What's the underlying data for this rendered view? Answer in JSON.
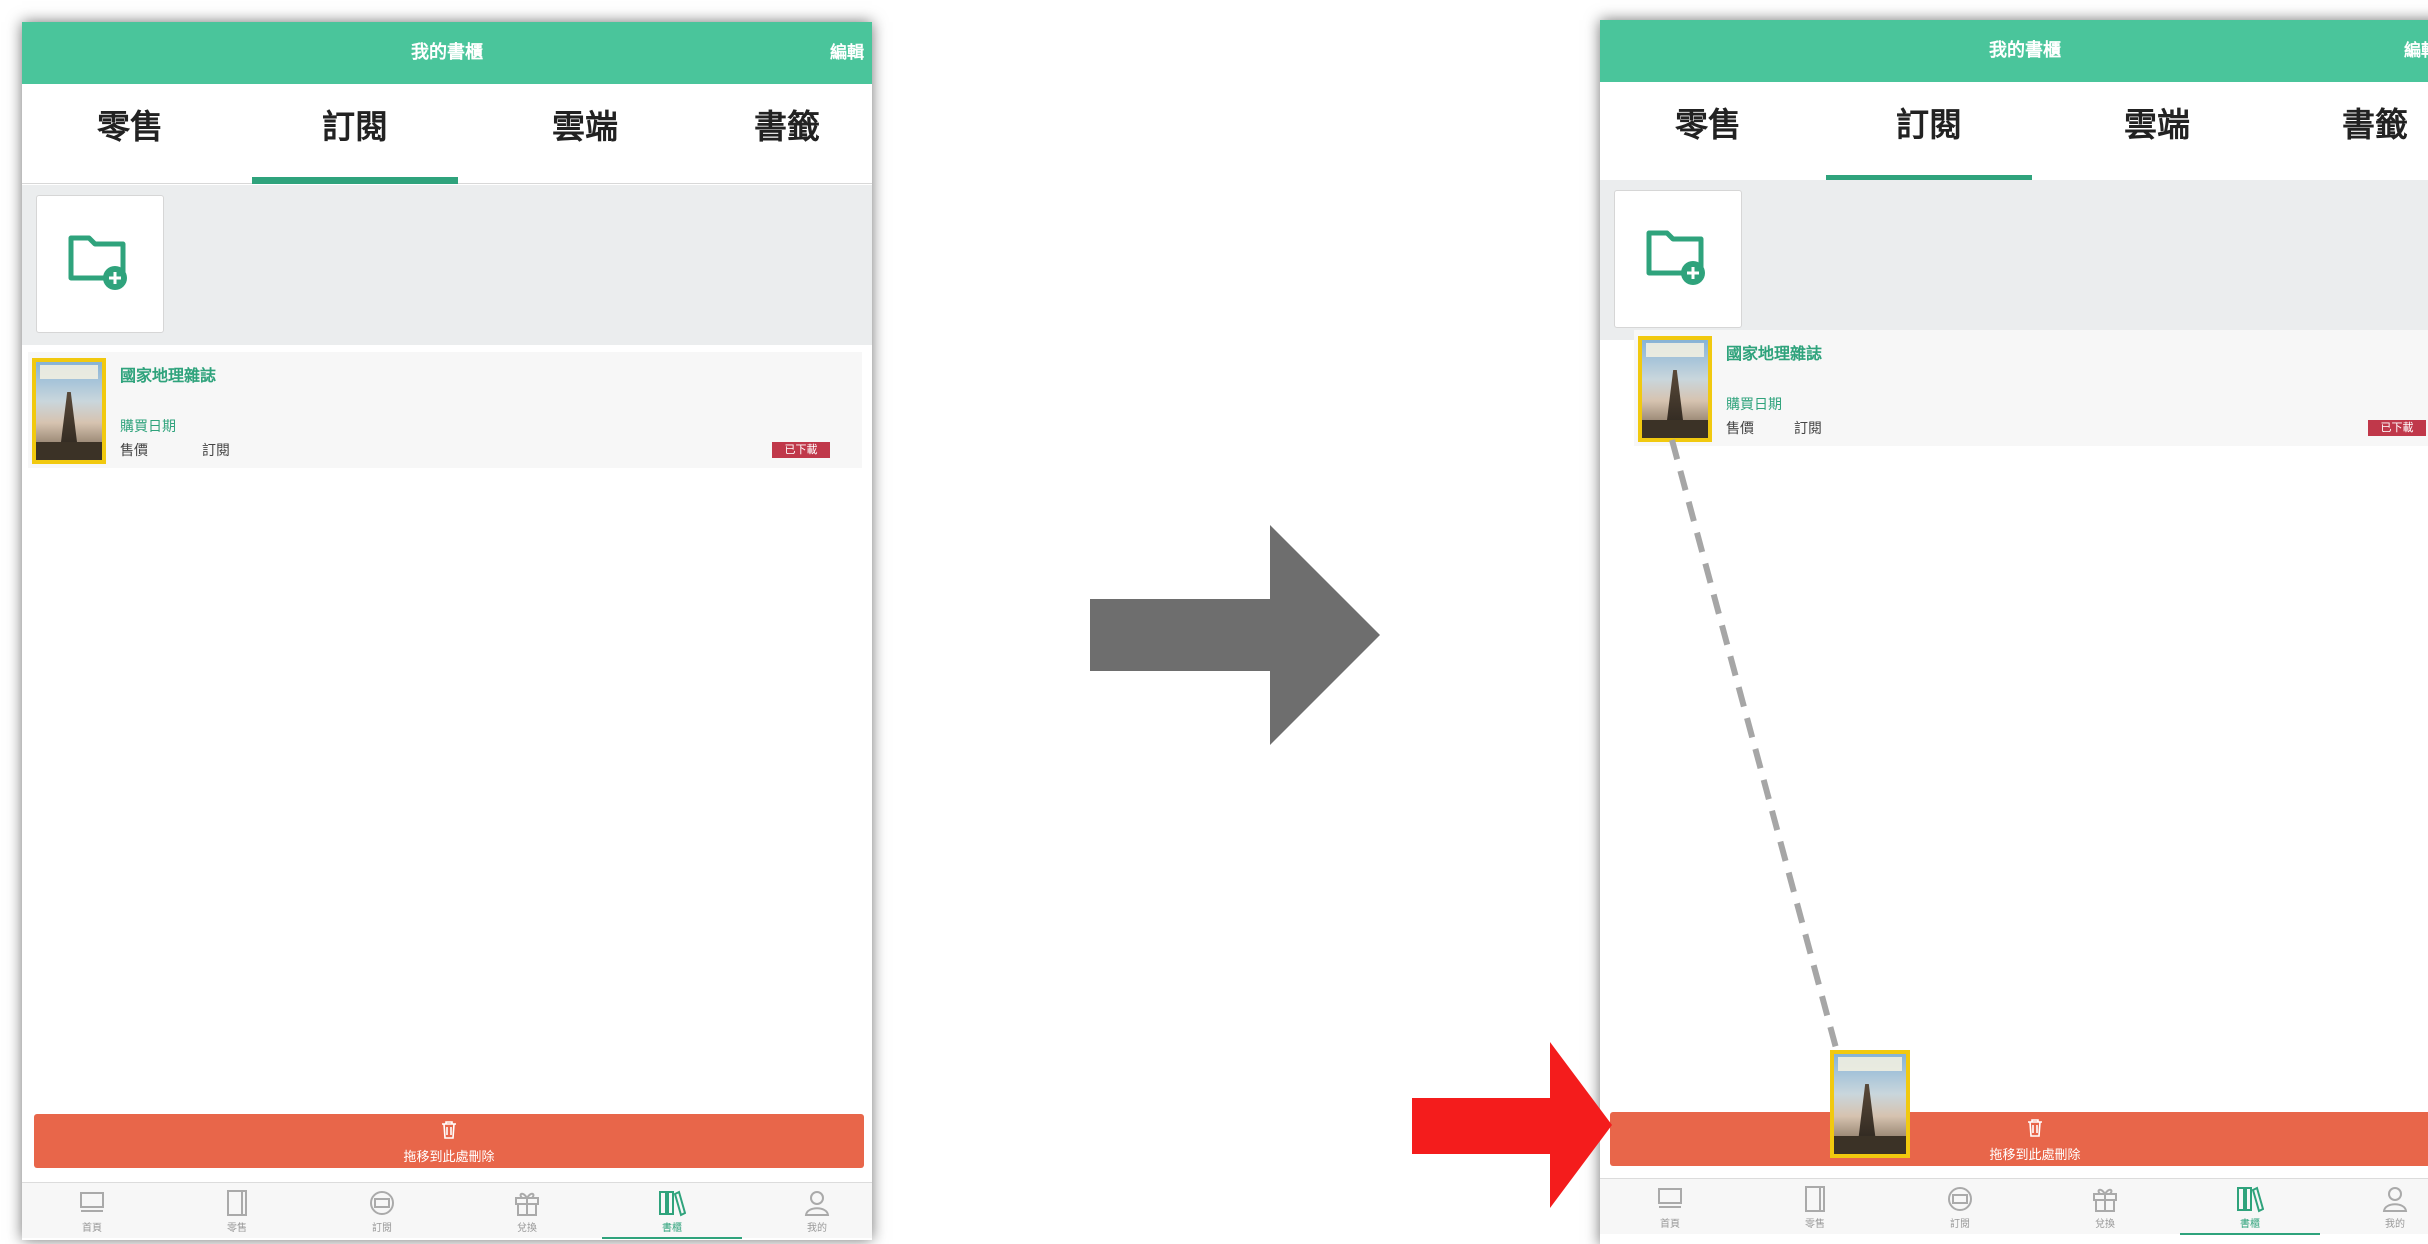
{
  "panel_left": {
    "header": {
      "title": "我的書櫃",
      "edit": "編輯"
    },
    "tabs": [
      "零售",
      "訂閱",
      "雲端",
      "書籤"
    ],
    "active_tab": "訂閱",
    "book": {
      "title": "國家地理雜誌",
      "date_label": "購買日期",
      "price_label": "售價",
      "type_label": "訂閱",
      "badge": "已下載"
    },
    "delete_bar_label": "拖移到此處刪除",
    "nav": [
      "首頁",
      "零售",
      "訂閱",
      "兌換",
      "書櫃",
      "我的"
    ],
    "active_nav": "書櫃"
  },
  "panel_right": {
    "header": {
      "title": "我的書櫃",
      "edit": "編輯"
    },
    "tabs": [
      "零售",
      "訂閱",
      "雲端",
      "書籤"
    ],
    "active_tab": "訂閱",
    "book": {
      "title": "國家地理雜誌",
      "date_label": "購買日期",
      "price_label": "售價",
      "type_label": "訂閱",
      "badge": "已下載"
    },
    "delete_bar_label": "拖移到此處刪除",
    "nav": [
      "首頁",
      "零售",
      "訂閱",
      "兌換",
      "書櫃",
      "我的"
    ],
    "active_nav": "書櫃"
  },
  "colors": {
    "header_green": "#4ac59b",
    "accent_green": "#2fa37c",
    "delete_orange": "#e8664a",
    "badge_red": "#c0384a",
    "arrow_gray": "#6e6e6e",
    "arrow_red": "#f41c1c",
    "cover_yellow": "#f1c90f"
  },
  "icons": {
    "folder_add": "folder-plus-icon",
    "trash": "trash-icon",
    "nav": [
      "home-icon",
      "book-icon",
      "subscribe-icon",
      "gift-icon",
      "bookshelf-icon",
      "user-icon"
    ]
  }
}
